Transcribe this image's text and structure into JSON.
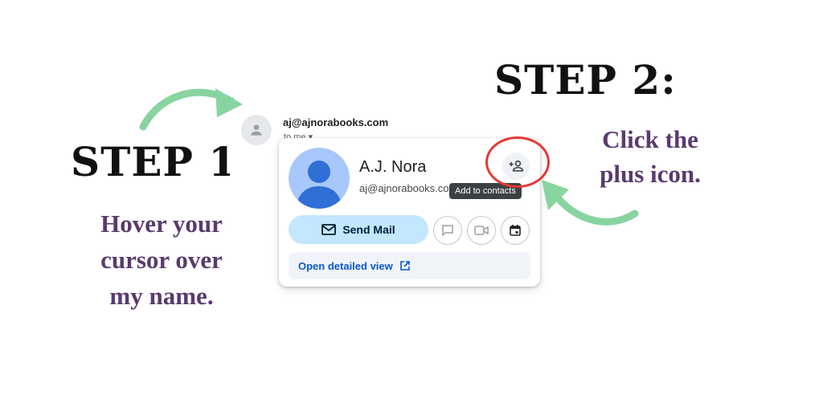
{
  "step1": {
    "title": "STEP 1:",
    "description": "Hover your cursor over my name."
  },
  "step2": {
    "title": "STEP 2:",
    "description": "Click the plus icon."
  },
  "email": {
    "sender": "aj@ajnorabooks.com",
    "recipient_label": "to me ▾"
  },
  "card": {
    "name": "A.J. Nora",
    "email": "aj@ajnorabooks.com",
    "add_tooltip": "Add to contacts",
    "send_mail_label": "Send Mail",
    "detail_link_label": "Open detailed view"
  },
  "colors": {
    "arrow": "#88d4a0",
    "highlight": "#e53935",
    "step_text": "#5a3a6e",
    "avatar_bg": "#a8c7fa",
    "avatar_fg": "#2f6fd6"
  },
  "icons": [
    "person-icon",
    "add-person-icon",
    "mail-icon",
    "chat-icon",
    "video-icon",
    "calendar-icon",
    "open-external-icon"
  ]
}
